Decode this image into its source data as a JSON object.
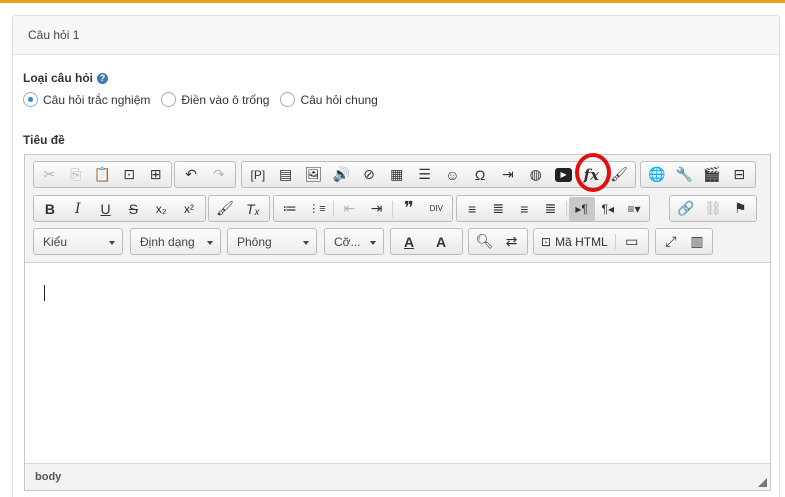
{
  "panel": {
    "title": "Câu hỏi 1"
  },
  "question_type": {
    "label": "Loại câu hỏi",
    "help_glyph": "?",
    "options": [
      {
        "label": "Câu hỏi trắc nghiệm",
        "selected": true
      },
      {
        "label": "Điền vào ô trống",
        "selected": false
      },
      {
        "label": "Câu hỏi chung",
        "selected": false
      }
    ]
  },
  "title_field": {
    "label": "Tiêu đề"
  },
  "toolbar": {
    "row1": {
      "clipboard": [
        "✂",
        "⎘",
        "📋",
        "⊡",
        "⊞"
      ],
      "history": [
        "↶",
        "↷"
      ],
      "insert": [
        "[P]",
        "▤",
        "🖼",
        "🔊",
        "⊘",
        "▦",
        "☰",
        "☺",
        "Ω",
        "⇥",
        "◍",
        "▶",
        "fx",
        "🖌"
      ],
      "extra": [
        "🌐",
        "🔧",
        "🎬",
        "⊟"
      ]
    },
    "row2": {
      "basic": [
        "B",
        "I",
        "U",
        "S",
        "x₂",
        "x²"
      ],
      "format": [
        "🖌",
        "Tₓ"
      ],
      "lists": [
        "≔",
        "⋮≡",
        "⇤",
        "⇥",
        "❞",
        "DIV"
      ],
      "align": [
        "≡",
        "≣",
        "≡",
        "≣"
      ],
      "dir": [
        "▸¶",
        "¶◂",
        "≡▾"
      ],
      "links": [
        "🔗",
        "⛓",
        "⚑"
      ]
    },
    "row3": {
      "combos": [
        {
          "label": "Kiểu"
        },
        {
          "label": "Định dạng"
        },
        {
          "label": "Phông"
        },
        {
          "label": "Cỡ..."
        }
      ],
      "text_color": "A",
      "bg_color": "A",
      "source_label": "Mã HTML"
    }
  },
  "status": {
    "path": "body"
  },
  "highlight_color": "#e01010",
  "accent": "#f0a01e"
}
